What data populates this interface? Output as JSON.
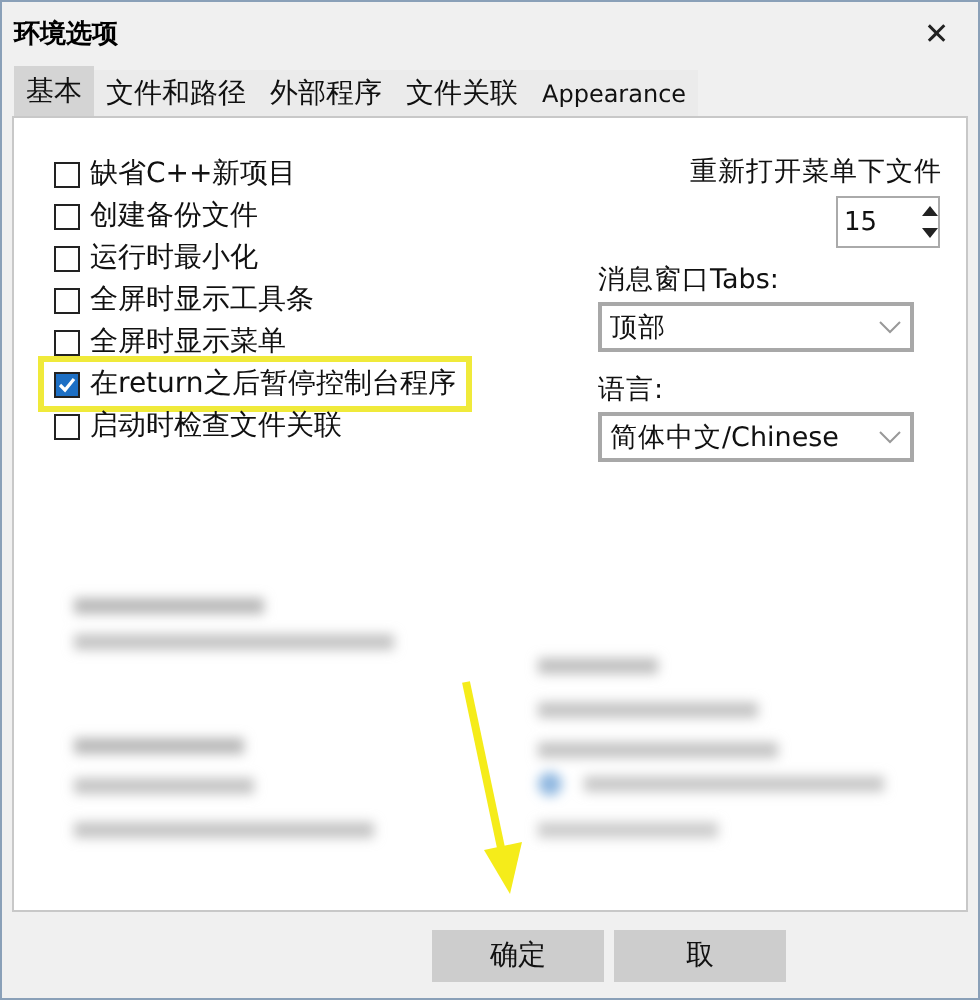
{
  "window": {
    "title": "环境选项",
    "close": "✕"
  },
  "tabs": [
    {
      "label": "基本",
      "selected": true
    },
    {
      "label": "文件和路径",
      "selected": false
    },
    {
      "label": "外部程序",
      "selected": false
    },
    {
      "label": "文件关联",
      "selected": false
    },
    {
      "label": "Appearance",
      "selected": false
    }
  ],
  "options": [
    {
      "label": "缺省C++新项目",
      "checked": false,
      "highlighted": false
    },
    {
      "label": "创建备份文件",
      "checked": false,
      "highlighted": false
    },
    {
      "label": "运行时最小化",
      "checked": false,
      "highlighted": false
    },
    {
      "label": "全屏时显示工具条",
      "checked": false,
      "highlighted": false
    },
    {
      "label": "全屏时显示菜单",
      "checked": false,
      "highlighted": false
    },
    {
      "label": "在return之后暂停控制台程序",
      "checked": true,
      "highlighted": true
    },
    {
      "label": "启动时检查文件关联",
      "checked": false,
      "highlighted": false
    }
  ],
  "reopen": {
    "label": "重新打开菜单下文件",
    "value": "15"
  },
  "message_tabs": {
    "label": "消息窗口Tabs:",
    "value": "顶部"
  },
  "language": {
    "label": "语言:",
    "value": "简体中文/Chinese"
  },
  "buttons": [
    "确定",
    "取"
  ]
}
